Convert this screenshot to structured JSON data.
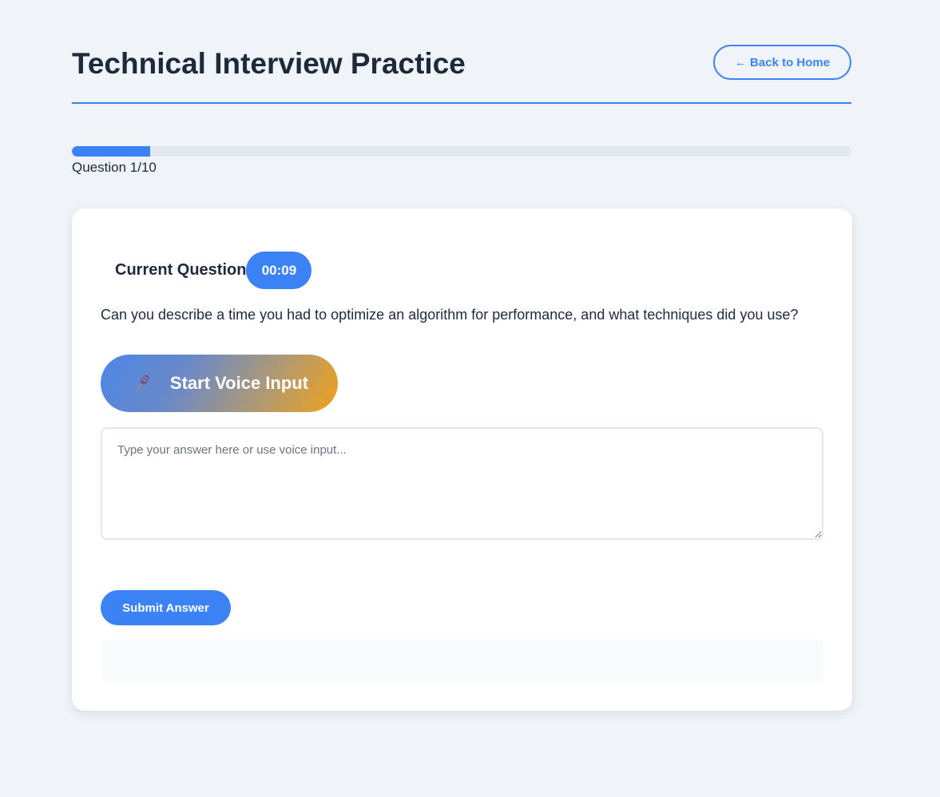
{
  "header": {
    "title": "Technical Interview Practice",
    "back_label": "← Back to Home"
  },
  "progress": {
    "current": 1,
    "total": 10,
    "fraction": 0.1,
    "label": "Question 1/10"
  },
  "question": {
    "heading": "Current Question",
    "timer": "00:09",
    "text": "Can you describe a time you had to optimize an algorithm for performance, and what techniques did you use?"
  },
  "voice": {
    "icon": "microphone-icon",
    "label": "Start Voice Input"
  },
  "answer": {
    "value": "",
    "placeholder": "Type your answer here or use voice input..."
  },
  "submit": {
    "label": "Submit Answer"
  },
  "feedback": {
    "text": ""
  },
  "colors": {
    "accent": "#3b82f6",
    "background": "#f0f4f8",
    "card": "#ffffff",
    "text": "#1e293b",
    "gradient_start": "#4b86e8",
    "gradient_end": "#f0a11a"
  }
}
